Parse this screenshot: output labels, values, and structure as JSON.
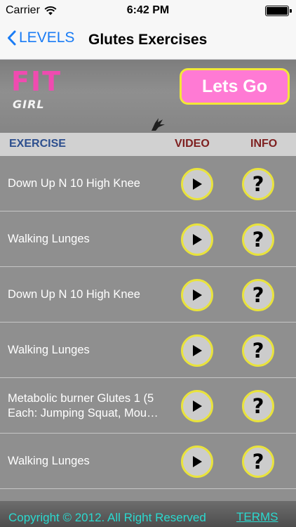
{
  "status_bar": {
    "carrier": "Carrier",
    "time": "6:42 PM",
    "wifi_icon": "wifi-icon",
    "battery_icon": "battery-icon",
    "battery_level": 1.0
  },
  "nav": {
    "back_label": "LEVELS",
    "back_icon": "chevron-left-icon",
    "title": "Glutes Exercises",
    "accent_color": "#1a7cf5"
  },
  "banner": {
    "logo_fit": "FIT",
    "logo_girl": "GIRL",
    "go_label": "Lets Go",
    "go_color": "#ff7ad4",
    "go_border_color": "#f2e836"
  },
  "columns": {
    "exercise": "EXERCISE",
    "video": "VIDEO",
    "info": "INFO"
  },
  "exercises": [
    {
      "name": "Down Up N 10 High Knee",
      "video_icon": "play-icon",
      "info_icon": "question-mark-icon"
    },
    {
      "name": "Walking Lunges",
      "video_icon": "play-icon",
      "info_icon": "question-mark-icon"
    },
    {
      "name": "Down Up N 10 High Knee",
      "video_icon": "play-icon",
      "info_icon": "question-mark-icon"
    },
    {
      "name": "Walking Lunges",
      "video_icon": "play-icon",
      "info_icon": "question-mark-icon"
    },
    {
      "name": "Metabolic burner Glutes 1 (5 Each: Jumping Squat, Mou…",
      "video_icon": "play-icon",
      "info_icon": "question-mark-icon"
    },
    {
      "name": "Walking Lunges",
      "video_icon": "play-icon",
      "info_icon": "question-mark-icon"
    }
  ],
  "info_glyph": "?",
  "footer": {
    "copyright": "Copyright © 2012. All Right Reserved",
    "terms": "TERMS",
    "text_color": "#2bd9cf"
  }
}
